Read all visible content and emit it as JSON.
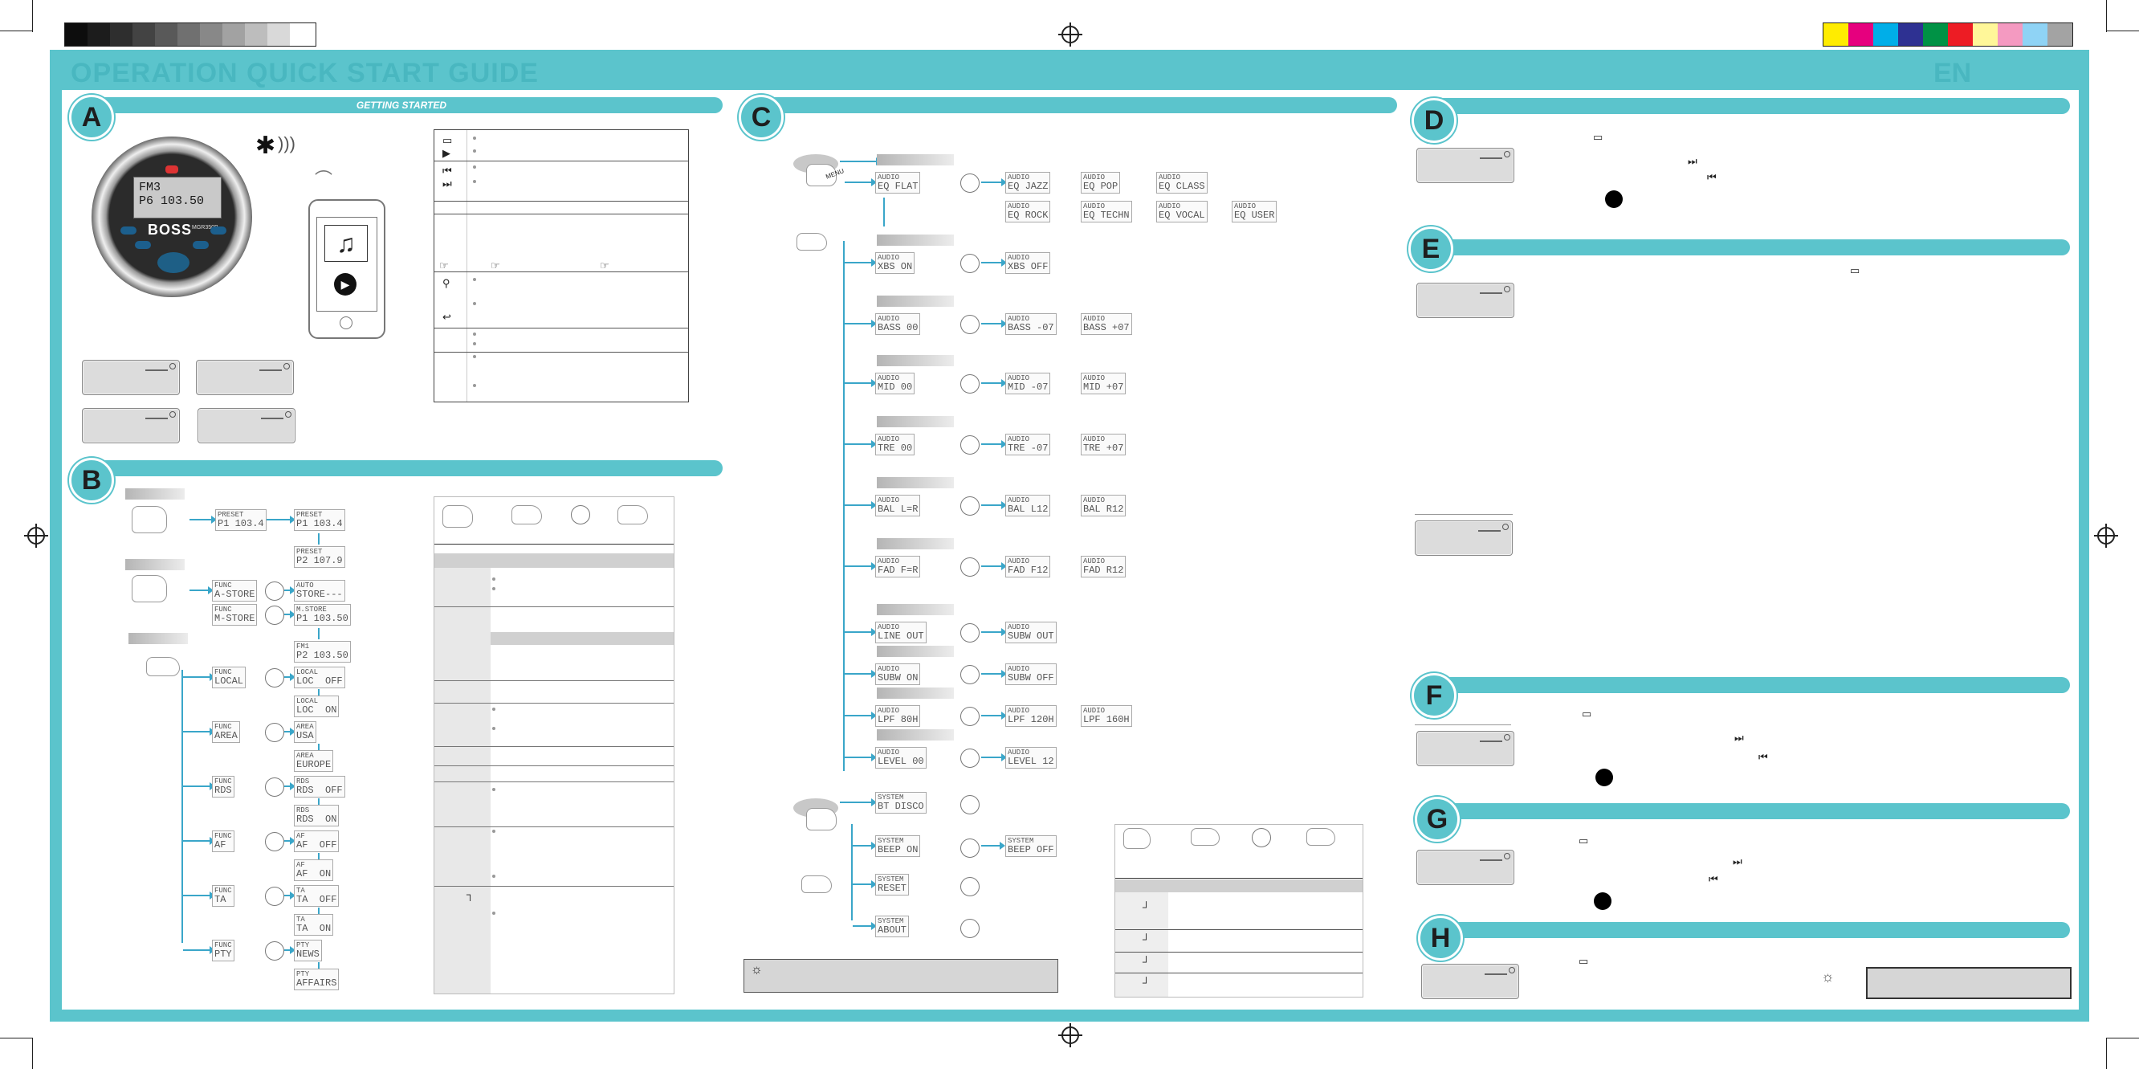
{
  "header": {
    "title": "OPERATION QUICK START GUIDE",
    "lang": "EN"
  },
  "colors": {
    "accent": "#5bc4cc",
    "flow_arrow": "#3aa6c9",
    "gray_swatches": [
      "#0d0d0d",
      "#1c1c1c",
      "#2e2e2e",
      "#434343",
      "#595959",
      "#707070",
      "#888888",
      "#a2a2a2",
      "#bdbdbd",
      "#d9d9d9",
      "#ffffff"
    ],
    "color_swatches": [
      "#ffec00",
      "#e6007e",
      "#00aee8",
      "#2e3192",
      "#009245",
      "#ed1c24",
      "#fff799",
      "#f49ac1",
      "#8fd3f5",
      "#a3a3a3"
    ]
  },
  "sections": {
    "A": {
      "letter": "A",
      "title": "GETTING STARTED"
    },
    "B": {
      "letter": "B"
    },
    "C": {
      "letter": "C"
    },
    "D": {
      "letter": "D"
    },
    "E": {
      "letter": "E"
    },
    "F": {
      "letter": "F"
    },
    "G": {
      "letter": "G"
    },
    "H": {
      "letter": "H"
    }
  },
  "device": {
    "brand": "BOSS",
    "model": "MGR350B",
    "display_line1": "FM3",
    "display_line2": "P6  103.50",
    "phone_icons": [
      "music-note-icon",
      "play-icon"
    ]
  },
  "section_b": {
    "preset_flow": [
      {
        "title": "PRESET",
        "value": "P1 103.4"
      },
      {
        "title": "PRESET",
        "value": "P1 103.4"
      },
      {
        "title": "PRESET",
        "value": "P2 107.9"
      }
    ],
    "store_flow": [
      {
        "title": "FUNC",
        "value": "A-STORE"
      },
      {
        "title": "AUTO",
        "value": "STORE---"
      },
      {
        "title": "FUNC",
        "value": "M-STORE"
      },
      {
        "title": "M.STORE",
        "value": "P1 103.50"
      },
      {
        "title": "FM1",
        "value": "P2 103.50"
      }
    ],
    "func_menu": [
      {
        "title": "FUNC",
        "value": "LOCAL",
        "opts": [
          {
            "title": "LOCAL",
            "value": "LOC  OFF"
          },
          {
            "title": "LOCAL",
            "value": "LOC  ON"
          }
        ]
      },
      {
        "title": "FUNC",
        "value": "AREA",
        "opts": [
          {
            "title": "AREA",
            "value": "USA"
          },
          {
            "title": "AREA",
            "value": "EUROPE"
          }
        ]
      },
      {
        "title": "FUNC",
        "value": "RDS",
        "opts": [
          {
            "title": "RDS",
            "value": "RDS  OFF"
          },
          {
            "title": "RDS",
            "value": "RDS  ON"
          }
        ]
      },
      {
        "title": "FUNC",
        "value": "AF",
        "opts": [
          {
            "title": "AF",
            "value": "AF  OFF"
          },
          {
            "title": "AF",
            "value": "AF  ON"
          }
        ]
      },
      {
        "title": "FUNC",
        "value": "TA",
        "opts": [
          {
            "title": "TA",
            "value": "TA  OFF"
          },
          {
            "title": "TA",
            "value": "TA  ON"
          }
        ]
      },
      {
        "title": "FUNC",
        "value": "PTY",
        "opts": [
          {
            "title": "PTY",
            "value": "NEWS"
          },
          {
            "title": "PTY",
            "value": "AFFAIRS"
          }
        ]
      }
    ]
  },
  "section_c": {
    "menu_label": "MENU",
    "audio": [
      {
        "title": "AUDIO",
        "value": "EQ FLAT",
        "opts": [
          {
            "title": "AUDIO",
            "value": "EQ JAZZ"
          },
          {
            "title": "AUDIO",
            "value": "EQ POP"
          },
          {
            "title": "AUDIO",
            "value": "EQ CLASS"
          },
          {
            "title": "AUDIO",
            "value": "EQ ROCK"
          },
          {
            "title": "AUDIO",
            "value": "EQ TECHN"
          },
          {
            "title": "AUDIO",
            "value": "EQ VOCAL"
          },
          {
            "title": "AUDIO",
            "value": "EQ USER"
          }
        ]
      },
      {
        "title": "AUDIO",
        "value": "XBS ON",
        "opts": [
          {
            "title": "AUDIO",
            "value": "XBS OFF"
          }
        ]
      },
      {
        "title": "AUDIO",
        "value": "BASS 00",
        "opts": [
          {
            "title": "AUDIO",
            "value": "BASS -07"
          },
          {
            "title": "AUDIO",
            "value": "BASS +07"
          }
        ]
      },
      {
        "title": "AUDIO",
        "value": "MID 00",
        "opts": [
          {
            "title": "AUDIO",
            "value": "MID -07"
          },
          {
            "title": "AUDIO",
            "value": "MID +07"
          }
        ]
      },
      {
        "title": "AUDIO",
        "value": "TRE 00",
        "opts": [
          {
            "title": "AUDIO",
            "value": "TRE -07"
          },
          {
            "title": "AUDIO",
            "value": "TRE +07"
          }
        ]
      },
      {
        "title": "AUDIO",
        "value": "BAL L=R",
        "opts": [
          {
            "title": "AUDIO",
            "value": "BAL L12"
          },
          {
            "title": "AUDIO",
            "value": "BAL R12"
          }
        ]
      },
      {
        "title": "AUDIO",
        "value": "FAD F=R",
        "opts": [
          {
            "title": "AUDIO",
            "value": "FAD F12"
          },
          {
            "title": "AUDIO",
            "value": "FAD R12"
          }
        ]
      },
      {
        "title": "AUDIO",
        "value": "LINE OUT",
        "opts": [
          {
            "title": "AUDIO",
            "value": "SUBW OUT"
          }
        ]
      },
      {
        "title": "AUDIO",
        "value": "SUBW ON",
        "opts": [
          {
            "title": "AUDIO",
            "value": "SUBW OFF"
          }
        ]
      },
      {
        "title": "AUDIO",
        "value": "LPF 80H",
        "opts": [
          {
            "title": "AUDIO",
            "value": "LPF 120H"
          },
          {
            "title": "AUDIO",
            "value": "LPF 160H"
          }
        ]
      },
      {
        "title": "AUDIO",
        "value": "LEVEL 00",
        "opts": [
          {
            "title": "AUDIO",
            "value": "LEVEL 12"
          }
        ]
      }
    ],
    "system": [
      {
        "title": "SYSTEM",
        "value": "BT DISCO"
      },
      {
        "title": "SYSTEM",
        "value": "BEEP ON",
        "opts": [
          {
            "title": "SYSTEM",
            "value": "BEEP OFF"
          }
        ]
      },
      {
        "title": "SYSTEM",
        "value": "RESET"
      },
      {
        "title": "SYSTEM",
        "value": "ABOUT"
      }
    ]
  }
}
